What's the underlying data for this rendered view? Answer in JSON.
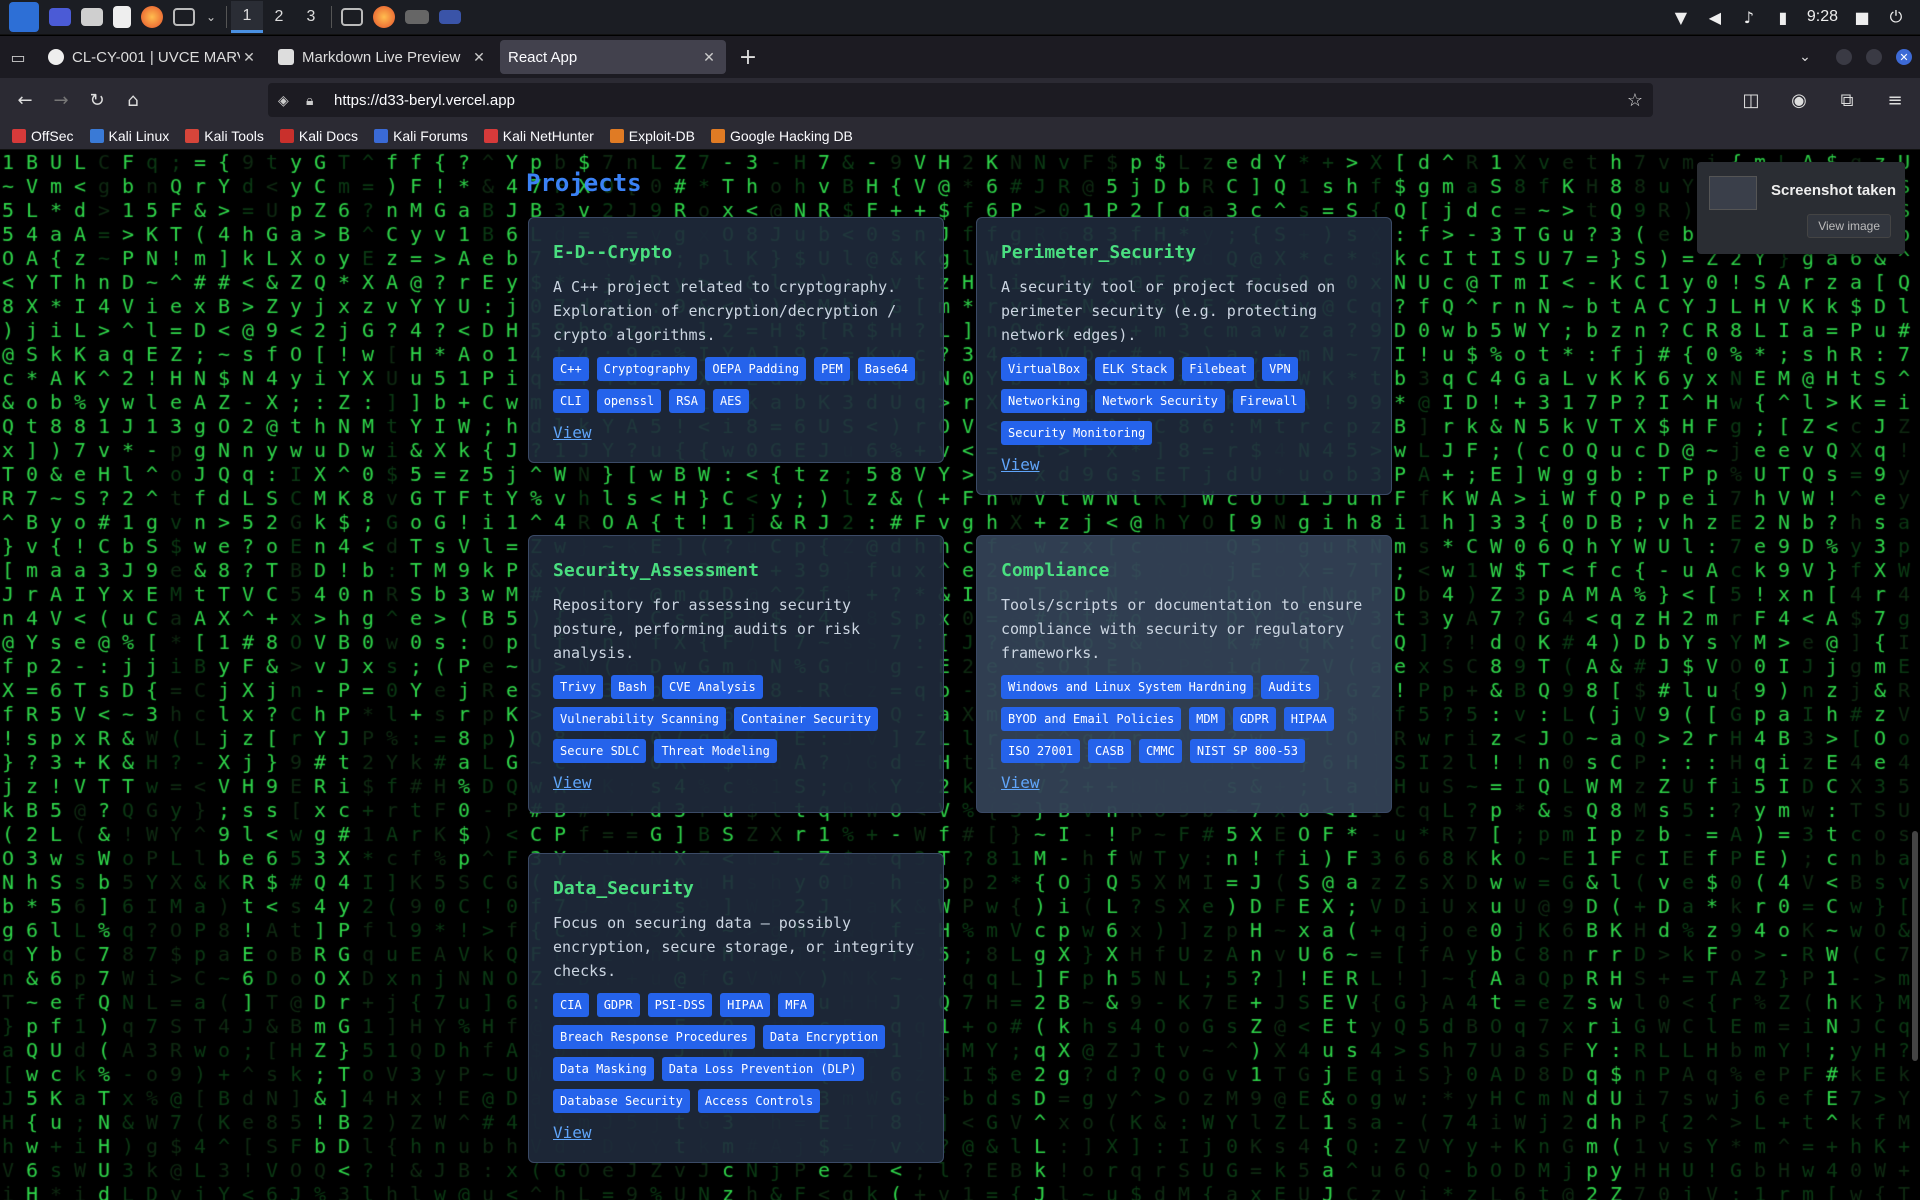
{
  "taskbar": {
    "workspaces": [
      "1",
      "2",
      "3"
    ],
    "clock": "9:28",
    "icons": [
      "kali-menu-icon",
      "desktop-icon",
      "file-manager-icon",
      "text-editor-icon",
      "firefox-icon",
      "terminal-icon",
      "chevron-down-icon"
    ]
  },
  "browser": {
    "tabs": [
      {
        "title": "CL-CY-001 | UVCE MARVEL",
        "active": false
      },
      {
        "title": "Markdown Live Preview",
        "active": false
      },
      {
        "title": "React App",
        "active": true
      }
    ],
    "url": "https://d33-beryl.vercel.app",
    "bookmarks": [
      "OffSec",
      "Kali Linux",
      "Kali Tools",
      "Kali Docs",
      "Kali Forums",
      "Kali NetHunter",
      "Exploit-DB",
      "Google Hacking DB"
    ]
  },
  "page": {
    "title": "Projects",
    "projects": [
      {
        "name": "E-D--Crypto",
        "description": "A C++ project related to cryptography. Exploration of encryption/decryption / crypto algorithms.",
        "tags": [
          "C++",
          "Cryptography",
          "OEPA Padding",
          "PEM",
          "Base64",
          "CLI",
          "openssl",
          "RSA",
          "AES"
        ],
        "link": "View"
      },
      {
        "name": "Perimeter_Security",
        "description": "A security tool or project focused on perimeter security (e.g. protecting network edges).",
        "tags": [
          "VirtualBox",
          "ELK Stack",
          "Filebeat",
          "VPN",
          "Networking",
          "Network Security",
          "Firewall",
          "Security Monitoring"
        ],
        "link": "View"
      },
      {
        "name": "Security_Assessment",
        "description": "Repository for assessing security posture, performing audits or risk analysis.",
        "tags": [
          "Trivy",
          "Bash",
          "CVE Analysis",
          "Vulnerability Scanning",
          "Container Security",
          "Secure SDLC",
          "Threat Modeling"
        ],
        "link": "View"
      },
      {
        "name": "Compliance",
        "description": "Tools/scripts or documentation to ensure compliance with security or regulatory frameworks.",
        "tags": [
          "Windows and Linux System Hardning",
          "Audits",
          "BYOD and Email Policies",
          "MDM",
          "GDPR",
          "HIPAA",
          "ISO 27001",
          "CASB",
          "CMMC",
          "NIST SP 800-53"
        ],
        "link": "View"
      },
      {
        "name": "Data_Security",
        "description": "Focus on securing data — possibly encryption, secure storage, or integrity checks.",
        "tags": [
          "CIA",
          "GDPR",
          "PSI-DSS",
          "HIPAA",
          "MFA",
          "Breach Response Procedures",
          "Data Encryption",
          "Data Masking",
          "Data Loss Prevention (DLP)",
          "Database Security",
          "Access Controls"
        ],
        "link": "View"
      }
    ]
  },
  "notification": {
    "title": "Screenshot taken",
    "button": "View image"
  },
  "colors": {
    "matrix_green": "#22c55e",
    "title_blue": "#3b82f6",
    "card_heading_green": "#4ade80",
    "tag_blue": "#2563eb",
    "link_blue": "#60a5fa"
  }
}
